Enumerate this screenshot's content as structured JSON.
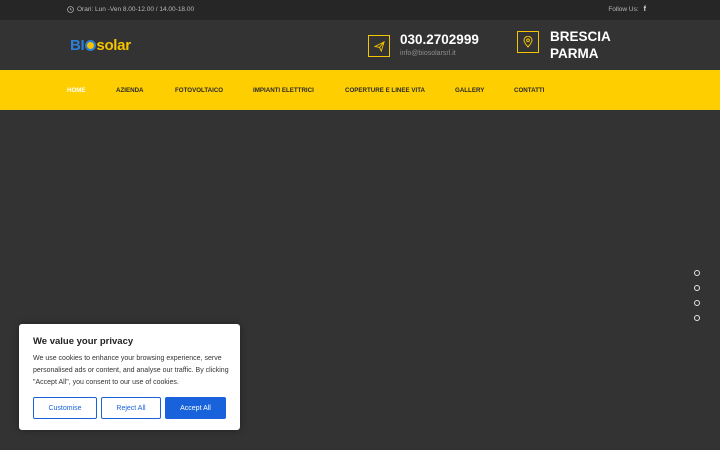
{
  "topbar": {
    "hours": "Orari: Lun -Ven 8.00-12.00 / 14.00-18.00",
    "follow_label": "Follow Us:",
    "social_icon": "facebook-icon"
  },
  "header": {
    "logo": {
      "part1": "BI",
      "part2": "solar"
    },
    "phone": "030.2702999",
    "email": "info@biosolarsrl.it",
    "city1": "BRESCIA",
    "city2": "PARMA"
  },
  "nav": {
    "items": [
      {
        "label": "HOME",
        "active": true
      },
      {
        "label": "AZIENDA"
      },
      {
        "label": "FOTOVOLTAICO"
      },
      {
        "label": "IMPIANTI ELETTRICI"
      },
      {
        "label": "COPERTURE E LINEE VITA"
      },
      {
        "label": "GALLERY"
      },
      {
        "label": "CONTATTI"
      }
    ]
  },
  "slider": {
    "dots": 4
  },
  "cookie": {
    "title": "We value your privacy",
    "text": "We use cookies to enhance your browsing experience, serve personalised ads or content, and analyse our traffic. By clicking \"Accept All\", you consent to our use of cookies.",
    "customise": "Customise",
    "reject": "Reject All",
    "accept": "Accept All"
  },
  "colors": {
    "accent": "#fece00",
    "dark": "#333333",
    "topbar": "#262626",
    "cookie_button": "#1863dc"
  }
}
